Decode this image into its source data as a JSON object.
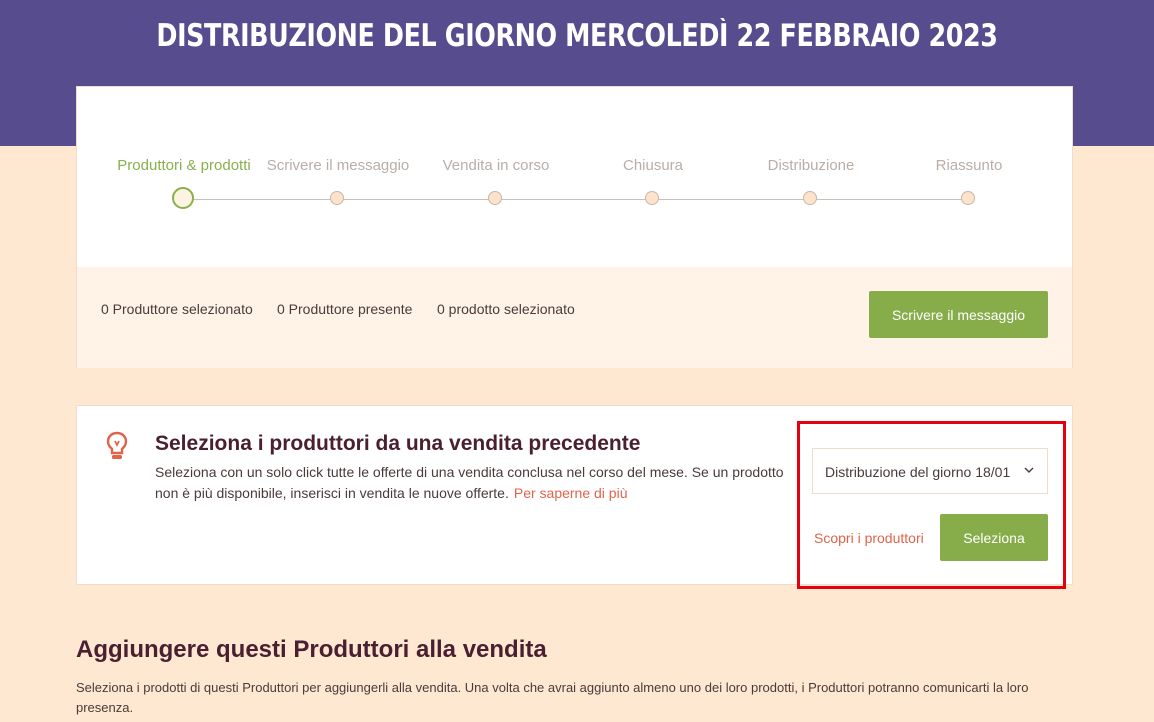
{
  "page_title": "DISTRIBUZIONE DEL GIORNO MERCOLEDÌ 22 FEBBRAIO 2023",
  "steps": [
    {
      "label": "Produttori & prodotti",
      "active": true
    },
    {
      "label": "Scrivere il messaggio",
      "active": false
    },
    {
      "label": "Vendita in corso",
      "active": false
    },
    {
      "label": "Chiusura",
      "active": false
    },
    {
      "label": "Distribuzione",
      "active": false
    },
    {
      "label": "Riassunto",
      "active": false
    }
  ],
  "summary": {
    "producers_selected": "0 Produttore selezionato",
    "producers_present": "0 Produttore presente",
    "products_selected": "0 prodotto selezionato",
    "write_button": "Scrivere il messaggio"
  },
  "previous_sale": {
    "title": "Seleziona i produttori da una vendita precedente",
    "description": "Seleziona con un solo click tutte le offerte di una vendita conclusa nel corso del mese. Se un prodotto non è più disponibile, inserisci in vendita le nuove offerte.",
    "learn_more": "Per saperne di più",
    "select_value": "Distribuzione del giorno 18/01",
    "discover_link": "Scopri i produttori",
    "select_button": "Seleziona"
  },
  "add_producers": {
    "title": "Aggiungere questi Produttori alla vendita",
    "description": "Seleziona i prodotti di questi Produttori per aggiungerli alla vendita. Una volta che avrai aggiunto almeno uno dei loro prodotti, i Produttori potranno comunicarti la loro presenza."
  },
  "colors": {
    "header": "#574c8e",
    "background": "#ffe8d1",
    "accent_green": "#87ad4a",
    "link_orange": "#e0644a",
    "highlight_red": "#e5000d"
  },
  "icons": {
    "lightbulb": "lightbulb-icon",
    "chevron": "chevron-down-icon"
  }
}
